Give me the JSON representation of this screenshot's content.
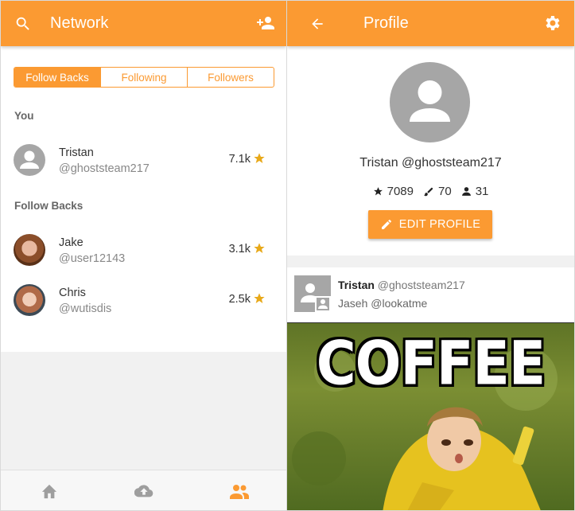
{
  "left": {
    "title": "Network",
    "tabs": [
      "Follow Backs",
      "Following",
      "Followers"
    ],
    "section_you": "You",
    "me": {
      "name": "Tristan",
      "handle": "@ghoststeam217",
      "score": "7.1k"
    },
    "section_follow_backs": "Follow Backs",
    "follow_backs": [
      {
        "name": "Jake",
        "handle": "@user12143",
        "score": "3.1k"
      },
      {
        "name": "Chris",
        "handle": "@wutisdis",
        "score": "2.5k"
      }
    ],
    "nav_icons": [
      "home-icon",
      "cloud-upload-icon",
      "people-icon"
    ]
  },
  "right": {
    "title": "Profile",
    "profile_name": "Tristan @ghoststeam217",
    "stats": {
      "stars": "7089",
      "brushes": "70",
      "followers": "31"
    },
    "edit_label": "EDIT PROFILE",
    "post": {
      "author": "Tristan",
      "author_handle": "@ghoststeam217",
      "mention": "Jaseh @lookatme"
    },
    "meme_text": "COFFEE"
  },
  "colors": {
    "accent": "#fb9a32",
    "star": "#e8a91a"
  }
}
